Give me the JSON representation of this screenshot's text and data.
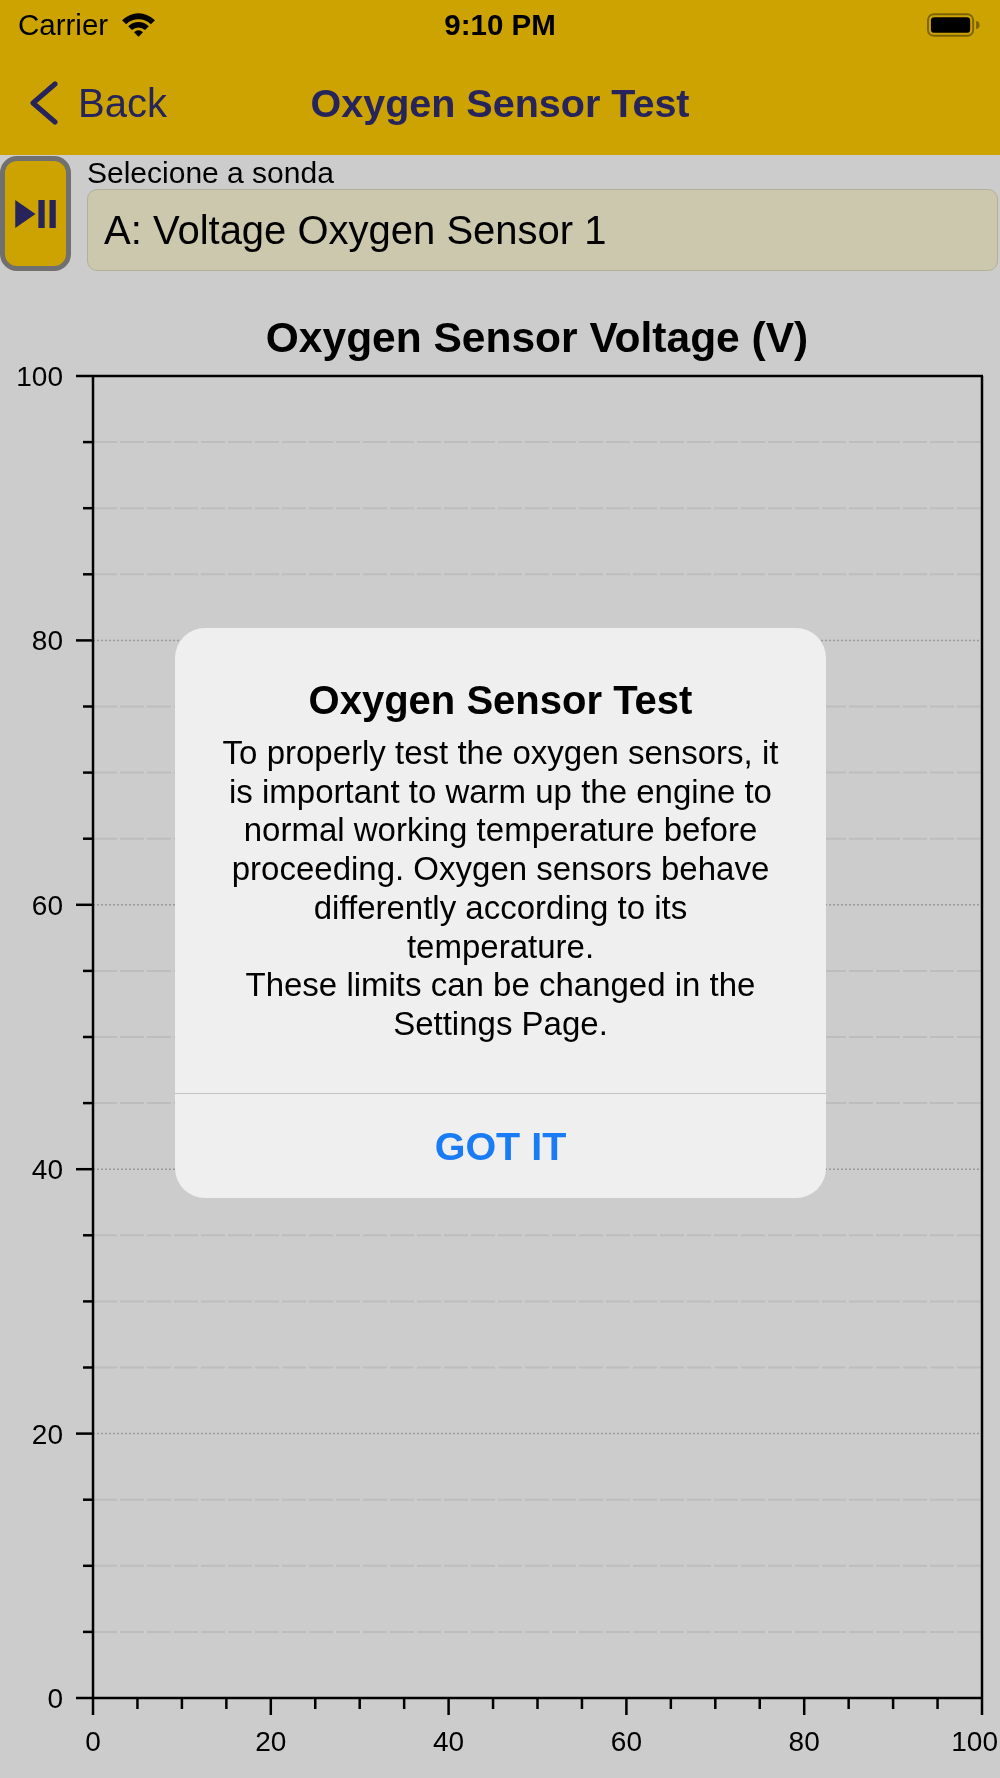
{
  "status_bar": {
    "carrier": "Carrier",
    "time": "9:10 PM"
  },
  "nav_bar": {
    "back_label": "Back",
    "title": "Oxygen Sensor Test"
  },
  "probe_selector": {
    "label": "Selecione a sonda",
    "value": "A: Voltage Oxygen Sensor 1"
  },
  "chart": {
    "chart_data": {
      "type": "line",
      "title": "Oxygen Sensor Voltage (V)",
      "xlim": [
        0,
        100
      ],
      "ylim": [
        0,
        100
      ],
      "xticks": [
        0,
        20,
        40,
        60,
        80,
        100
      ],
      "yticks": [
        0,
        20,
        40,
        60,
        80,
        100
      ],
      "grid": true
    }
  },
  "alert": {
    "title": "Oxygen Sensor Test",
    "message": "To properly test the oxygen sensors, it is important to warm up the engine to normal working temperature before proceeding. Oxygen sensors behave differently according to its temperature.\nThese limits can be changed in the Settings Page.",
    "button": "GOT IT"
  }
}
